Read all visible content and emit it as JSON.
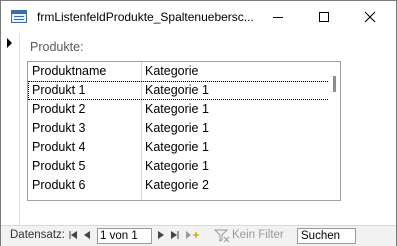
{
  "window": {
    "title": "frmListenfeldProdukte_Spaltenuebersc...",
    "icon": "form-icon"
  },
  "form": {
    "label": "Produkte:",
    "listbox": {
      "columns": [
        "Produktname",
        "Kategorie"
      ],
      "rows": [
        [
          "Produkt 1",
          "Kategorie 1"
        ],
        [
          "Produkt 2",
          "Kategorie 1"
        ],
        [
          "Produkt 3",
          "Kategorie 1"
        ],
        [
          "Produkt 4",
          "Kategorie 1"
        ],
        [
          "Produkt 5",
          "Kategorie 1"
        ],
        [
          "Produkt 6",
          "Kategorie 2"
        ]
      ],
      "selected_index": 0
    }
  },
  "navigation": {
    "label": "Datensatz:",
    "record_position": "1 von 1",
    "filter_label": "Kein Filter",
    "search_placeholder": "Suchen"
  }
}
